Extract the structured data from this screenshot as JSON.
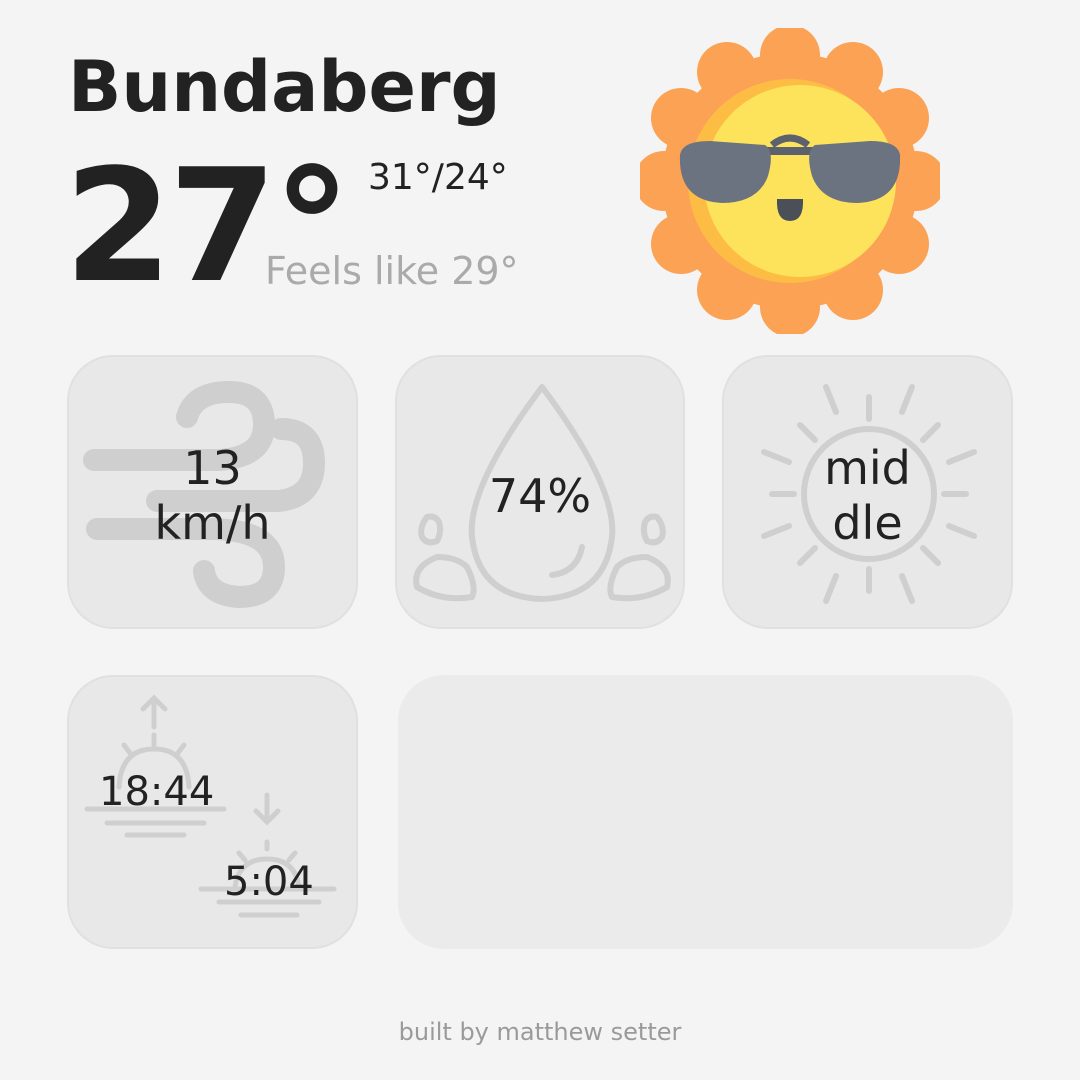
{
  "location": {
    "city": "Bundaberg"
  },
  "current": {
    "temperature": "27°",
    "high_low": "31°/24°",
    "feels_like": "Feels like 29°",
    "condition_icon": "sun-with-sunglasses-icon"
  },
  "cards": {
    "wind": {
      "value_line1": "13",
      "value_line2": "km/h",
      "icon": "wind-icon"
    },
    "humidity": {
      "value": "74%",
      "icon": "water-drop-icon"
    },
    "uv": {
      "value_line1": "mid",
      "value_line2": "dle",
      "icon": "sun-rays-icon"
    },
    "sun_times": {
      "sunset": "18:44",
      "sunrise": "5:04",
      "sunset_icon": "sunset-icon",
      "sunrise_icon": "sunrise-icon"
    }
  },
  "footer": {
    "credit": "built by matthew setter"
  },
  "colors": {
    "background": "#f4f4f4",
    "card": "#e8e8e8",
    "card_icon": "#cfcfcf",
    "sun_outer": "#fba255",
    "sun_inner": "#fde25c",
    "sunglasses": "#6b7280"
  }
}
